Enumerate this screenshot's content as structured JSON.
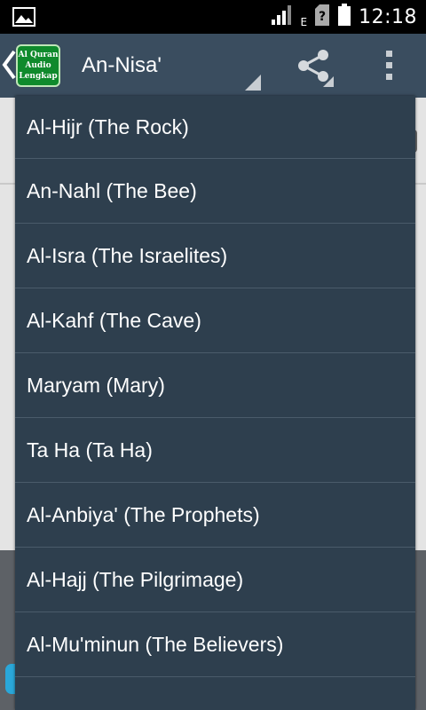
{
  "status_bar": {
    "time": "12:18",
    "network_label": "E"
  },
  "action_bar": {
    "logo_lines": [
      "Al Quran",
      "Audio",
      "Lengkap"
    ],
    "selected_surah": "An-Nisa'"
  },
  "dropdown": {
    "items": [
      "Al-Hijr (The Rock)",
      "An-Nahl (The Bee)",
      "Al-Isra (The Israelites)",
      "Al-Kahf (The Cave)",
      "Maryam (Mary)",
      "Ta Ha (Ta Ha)",
      "Al-Anbiya' (The Prophets)",
      "Al-Hajj (The Pilgrimage)",
      "Al-Mu'minun (The Believers)",
      ""
    ]
  },
  "icons": {
    "gallery": "gallery-notification-icon",
    "signal": "signal-bars-icon",
    "sim": "sim-unknown-icon",
    "battery": "battery-icon",
    "back": "back-chevron-icon",
    "share": "share-icon",
    "overflow": "overflow-menu-icon"
  },
  "colors": {
    "action_bar": "#3a4d5f",
    "dropdown_bg": "#2e3f4e",
    "divider": "#4a5b6a",
    "logo_green": "#0f8a2c"
  }
}
